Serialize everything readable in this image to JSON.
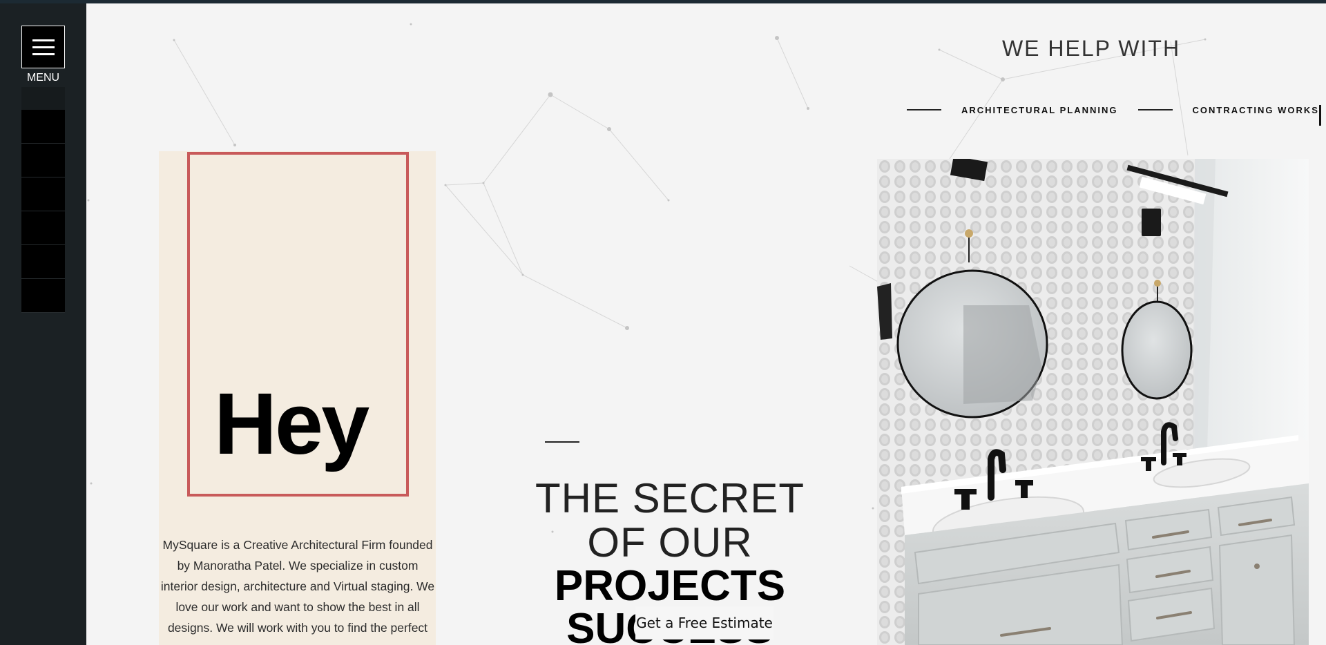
{
  "sidebar": {
    "menu_label": "MENU",
    "slot_count": 6
  },
  "intro": {
    "heading": "Hey",
    "text": "MySquare is a Creative Architectural Firm founded by Manoratha Patel. We specialize in custom interior design, architecture and Virtual staging. We love our work and want to show the best in all designs. We will work with you to find the perfect"
  },
  "hero": {
    "line1": "THE SECRET",
    "line2": "OF OUR",
    "line3": "PROJECTS",
    "line4": "SUCCESS"
  },
  "cta": {
    "label": "Get a Free Estimate"
  },
  "help": {
    "title": "WE HELP WITH",
    "services": [
      "ARCHITECTURAL PLANNING",
      "CONTRACTING WORKS"
    ]
  },
  "colors": {
    "sidebar": "#1b2124",
    "card": "#f4ece0",
    "frame": "#c85a5a",
    "background": "#f4f4f4"
  }
}
